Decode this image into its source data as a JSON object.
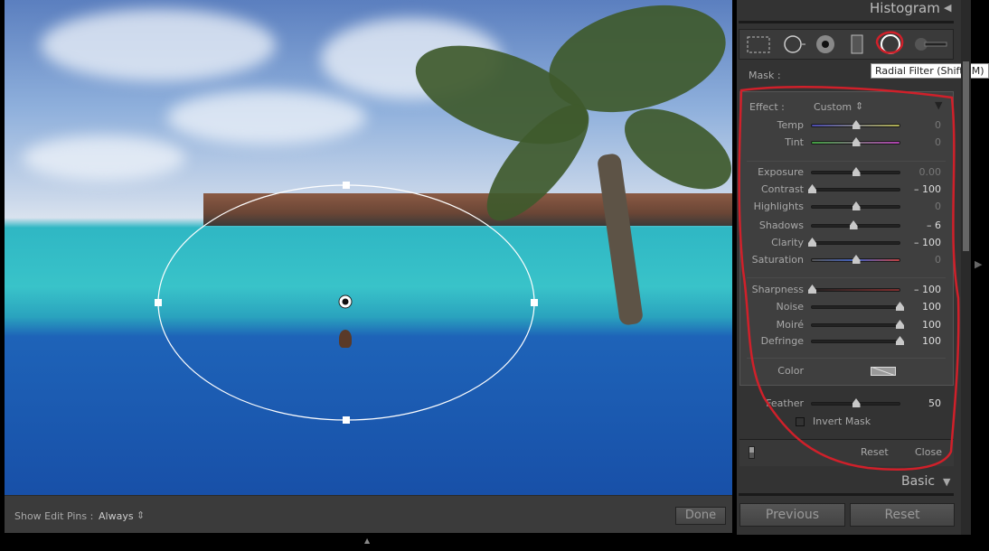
{
  "panel": {
    "title": "Histogram",
    "mask_label": "Mask :",
    "tooltip": "Radial Filter (Shift+M)",
    "tools": [
      "graduated-filter-icon",
      "crop-overlay-icon",
      "spot-removal-icon",
      "red-eye-icon",
      "radial-filter-icon",
      "adjustment-brush-icon"
    ],
    "effect_label": "Effect :",
    "effect_value": "Custom",
    "sliders": [
      {
        "label": "Temp",
        "value": "0",
        "pos": 0.5,
        "grad": "linear-gradient(90deg,#4a4ab0,#b0b050)"
      },
      {
        "label": "Tint",
        "value": "0",
        "pos": 0.5,
        "grad": "linear-gradient(90deg,#40a040,#b040b0)"
      },
      {
        "label": "Exposure",
        "value": "0.00",
        "pos": 0.5
      },
      {
        "label": "Contrast",
        "value": "– 100",
        "pos": 0
      },
      {
        "label": "Highlights",
        "value": "0",
        "pos": 0.5
      },
      {
        "label": "Shadows",
        "value": "– 6",
        "pos": 0.47
      },
      {
        "label": "Clarity",
        "value": "– 100",
        "pos": 0
      },
      {
        "label": "Saturation",
        "value": "0",
        "pos": 0.5,
        "grad": "linear-gradient(90deg,#555,#4060c0,#c04040)"
      },
      {
        "label": "Sharpness",
        "value": "– 100",
        "pos": 0,
        "grad": "linear-gradient(90deg,#222,#803030)"
      },
      {
        "label": "Noise",
        "value": "100",
        "pos": 1
      },
      {
        "label": "Moiré",
        "value": "100",
        "pos": 1
      },
      {
        "label": "Defringe",
        "value": "100",
        "pos": 1
      }
    ],
    "color_label": "Color",
    "feather_label": "Feather",
    "feather_value": "50",
    "feather_pos": 0.5,
    "invert_label": "Invert Mask",
    "invert_checked": false,
    "reset": "Reset",
    "close": "Close",
    "basic": "Basic",
    "previous": "Previous",
    "reset_all": "Reset"
  },
  "toolbar": {
    "pins_label": "Show Edit Pins :",
    "pins_value": "Always",
    "done": "Done"
  },
  "colors": {
    "annotation": "#d0202a"
  }
}
